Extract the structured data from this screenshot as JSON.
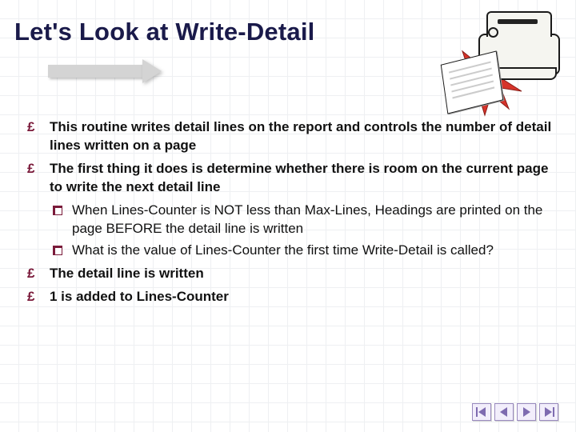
{
  "title": "Let's Look at Write-Detail",
  "bullets": [
    {
      "text": "This routine writes detail lines on the  report and controls the number of detail  lines written on a page"
    },
    {
      "text": "The first thing it does is determine whether there is room on the current page to write the next detail line",
      "sub": [
        "When Lines-Counter is NOT less than Max-Lines, Headings are printed on the page BEFORE the detail line is written",
        "What is the value of Lines-Counter the first time Write-Detail is called?"
      ]
    },
    {
      "text": "The detail line is written"
    },
    {
      "text": "1 is added to Lines-Counter"
    }
  ],
  "nav": {
    "first": "first-slide",
    "prev": "previous-slide",
    "next": "next-slide",
    "last": "last-slide"
  },
  "colors": {
    "accent": "#7a1a3a",
    "title": "#1a1a4a",
    "navFill": "#7e6bb0"
  }
}
